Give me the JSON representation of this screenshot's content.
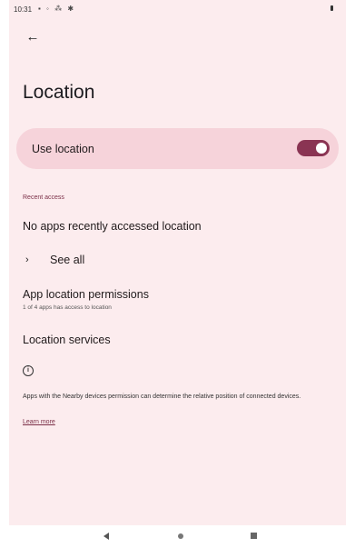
{
  "status_bar": {
    "time": "10:31",
    "icons": [
      "notification-icon",
      "signal-icon",
      "hash-icon",
      "settings-icon"
    ],
    "icon_glyphs": "▪ ◦ ⁂ ✱"
  },
  "header": {
    "back_icon": "←",
    "title": "Location"
  },
  "use_location": {
    "label": "Use location",
    "enabled": true
  },
  "recent_access": {
    "section_label": "Recent access",
    "empty_text": "No apps recently accessed location",
    "see_all_chevron": "›",
    "see_all_label": "See all"
  },
  "settings": {
    "app_permissions_title": "App location permissions",
    "app_permissions_subtitle": "1 of 4 apps has access to location",
    "location_services_title": "Location services"
  },
  "info": {
    "icon_glyph": "i",
    "text": "Apps with the Nearby devices permission can determine the relative position of connected devices.",
    "learn_more": "Learn more"
  },
  "colors": {
    "background": "#fcecee",
    "card": "#f6d3da",
    "accent": "#8a3453"
  }
}
